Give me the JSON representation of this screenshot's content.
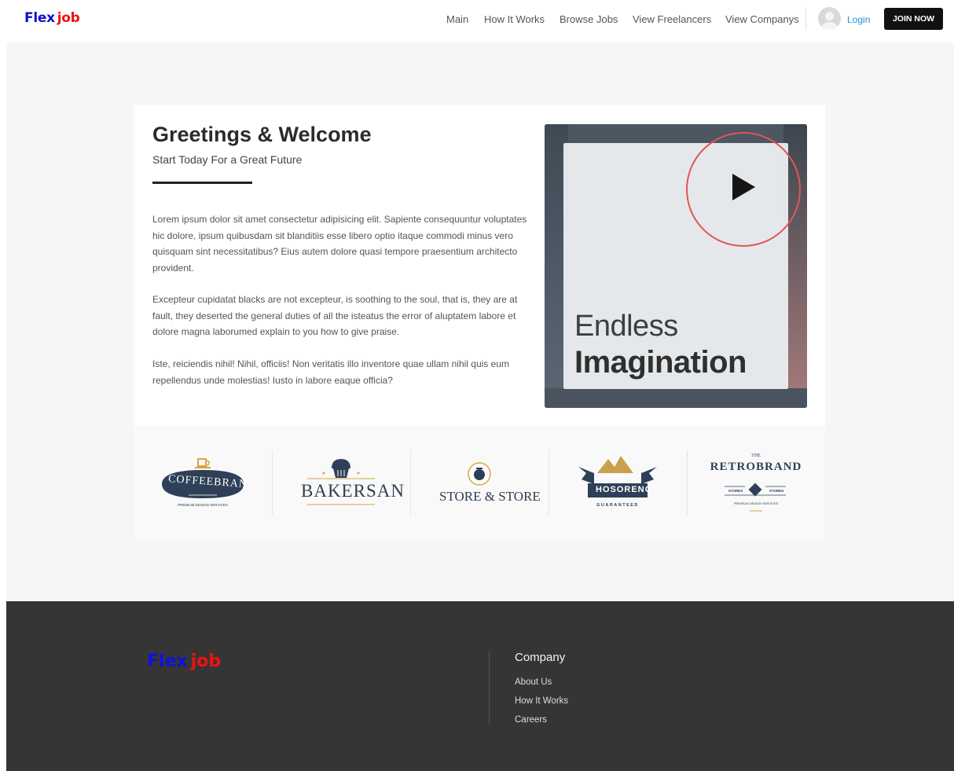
{
  "header": {
    "logo_part1": "Flex",
    "logo_part2": "job",
    "nav": [
      "Main",
      "How It Works",
      "Browse Jobs",
      "View Freelancers",
      "View Companys"
    ],
    "login": "Login",
    "join": "JOIN NOW"
  },
  "welcome": {
    "title": "Greetings & Welcome",
    "subtitle": "Start Today For a Great Future",
    "paragraphs": [
      "Lorem ipsum dolor sit amet consectetur adipisicing elit. Sapiente consequuntur voluptates hic dolore, ipsum quibusdam sit blanditiis esse libero optio itaque commodi minus vero quisquam sint necessitatibus? Eius autem dolore quasi tempore praesentium architecto provident.",
      "Excepteur cupidatat blacks are not excepteur, is soothing to the soul, that is, they are at fault, they deserted the general duties of all the isteatus the error of aluptatem labore et dolore magna laborumed explain to you how to give praise.",
      "Iste, reiciendis nihil! Nihil, officiis! Non veritatis illo inventore quae ullam nihil quis eum repellendus unde molestias! Iusto in labore eaque officia?"
    ]
  },
  "video": {
    "line1": "Endless",
    "line2": "Imagination"
  },
  "brands": {
    "coffee": {
      "name": "COFFEEBRAND",
      "tagline": "PREMIUM DESIGN SERVICES"
    },
    "bakersan": {
      "name": "BAKERSAN"
    },
    "store": {
      "name": "STORE & STORE"
    },
    "hosoreno": {
      "name": "HOSORENO",
      "tagline": "GUARANTEED"
    },
    "retro": {
      "top": "THE",
      "name": "RETROBRAND",
      "left": "STORES",
      "right": "STORES",
      "tagline": "PREMIUM DESIGN SERVICES"
    }
  },
  "colors": {
    "brand_blue": "#1010cc",
    "brand_red": "#ee1111",
    "join_bg": "#111111",
    "footer_bg": "#353535",
    "login": "#2a8fd8"
  },
  "footer": {
    "logo_part1": "Flex",
    "logo_part2": "job",
    "heading": "Company",
    "links": [
      "About Us",
      "How It Works",
      "Careers"
    ]
  }
}
